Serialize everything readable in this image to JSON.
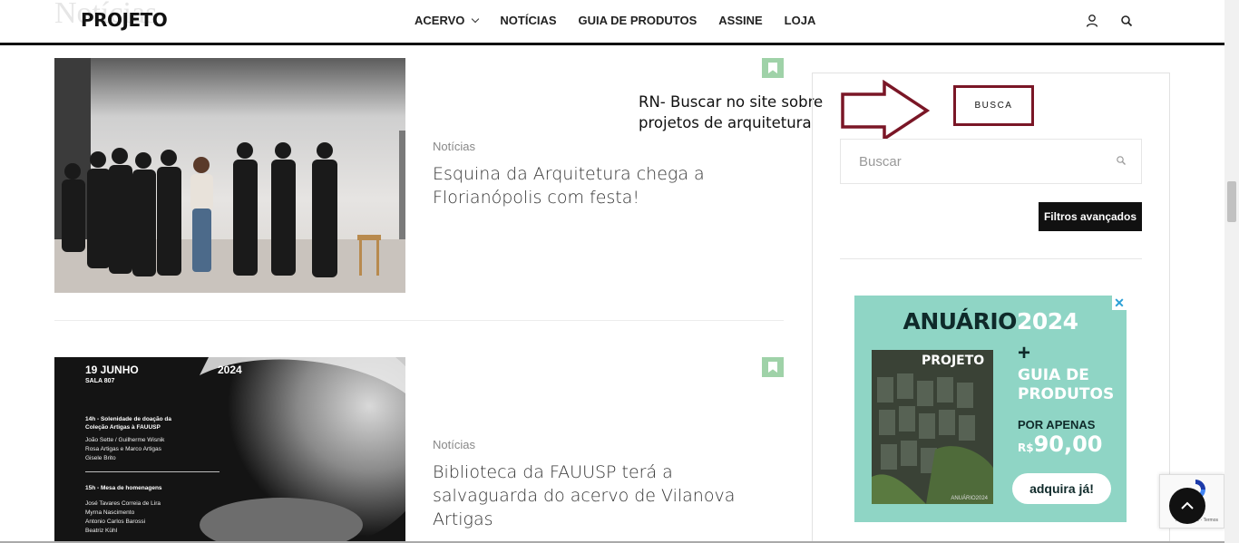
{
  "page": {
    "ghost_title": "Notícias"
  },
  "header": {
    "logo": "PROJETO",
    "nav": [
      {
        "label": "ACERVO",
        "has_dropdown": true
      },
      {
        "label": "NOTÍCIAS"
      },
      {
        "label": "GUIA DE PRODUTOS"
      },
      {
        "label": "ASSINE"
      },
      {
        "label": "LOJA"
      }
    ],
    "icons": [
      "user-icon",
      "search-icon"
    ]
  },
  "articles": [
    {
      "category": "Notícias",
      "title": "Esquina da Arquitetura chega a Florianópolis com festa!"
    },
    {
      "category": "Notícias",
      "title": "Biblioteca da FAUUSP terá a salvaguarda do acervo de Vilanova Artigas",
      "poster": {
        "date": "19 JUNHO",
        "year": "2024",
        "room": "SALA 807",
        "lines": [
          "14h - Solenidade de doação da",
          "Coleção Artigas à FAUUSP",
          "João Sette / Guilherme Wisnik",
          "Rosa Artigas e Marco Artigas",
          "Gisele Brito",
          "15h - Mesa de homenagens",
          "José Tavares Correia de Lira",
          "Myrna Nascimento",
          "Antonio Carlos Barossi",
          "Beatriz Kühl"
        ]
      }
    }
  ],
  "annotation": {
    "line1": "RN- Buscar no site sobre",
    "line2": "projetos de arquitetura"
  },
  "sidebar": {
    "busca_label": "BUSCA",
    "search_placeholder": "Buscar",
    "advanced_button": "Filtros avançados"
  },
  "ad": {
    "head_a": "ANUÁRIO",
    "head_b": "2024",
    "book_title": "PROJETO",
    "book_footer": "ANUÁRIO2024",
    "plus": "+",
    "guia_line1": "GUIA DE",
    "guia_line2": "PRODUTOS",
    "por_apenas": "POR APENAS",
    "currency": "R$",
    "price": "90,00",
    "cta": "adquira já!",
    "close": "✕"
  },
  "recaptcha": {
    "label": "Privacidade - Termos"
  },
  "colors": {
    "annotation_red": "#7a1626",
    "bookmark_green": "#9fd2a8",
    "ad_teal": "#8fd5c5"
  }
}
